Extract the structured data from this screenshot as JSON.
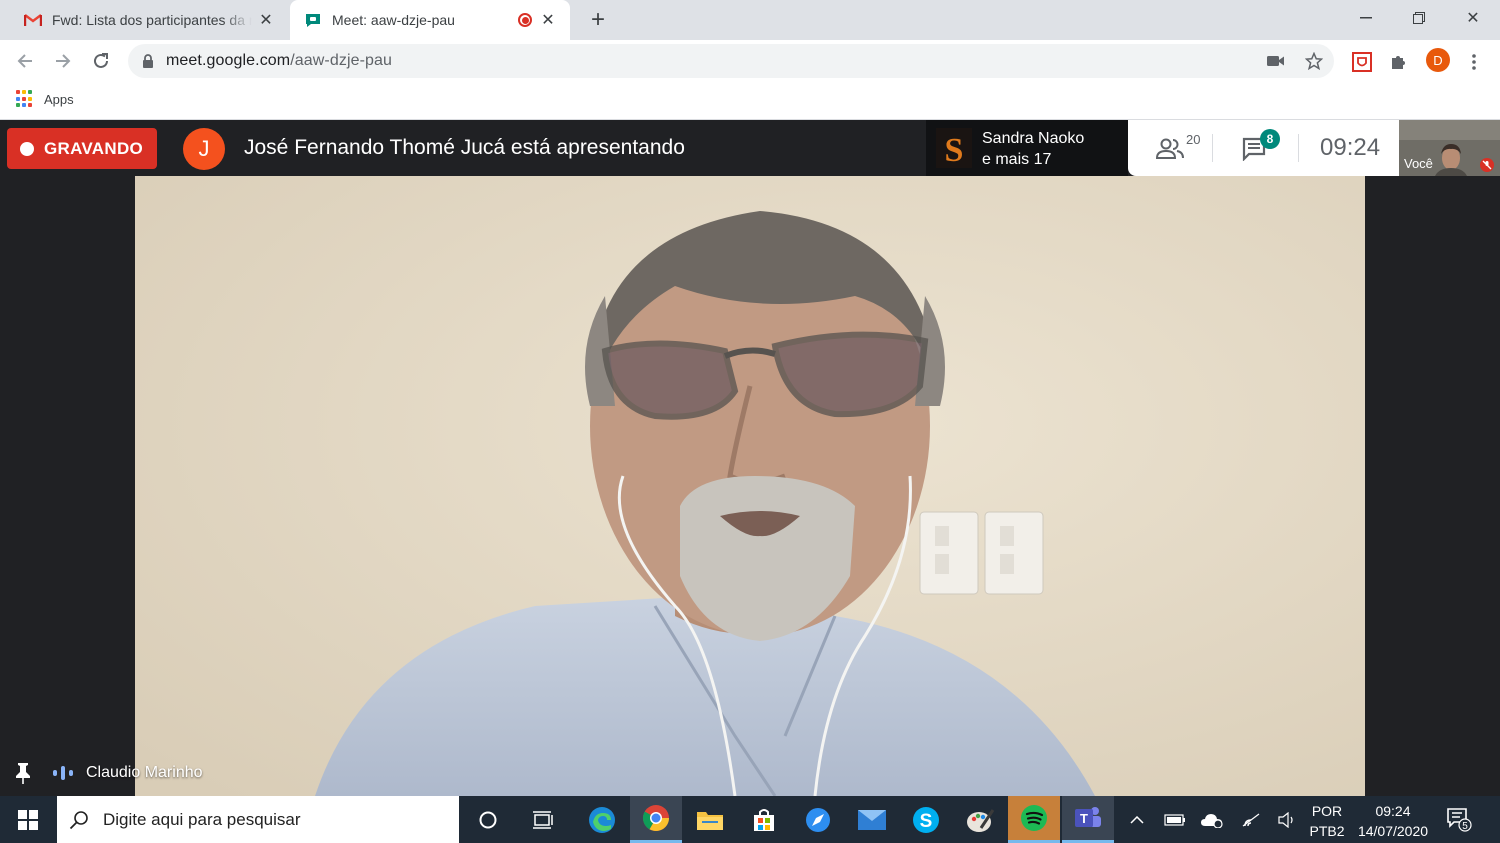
{
  "browser": {
    "tabs": [
      {
        "title": "Fwd: Lista dos participantes da re",
        "icon": "gmail-icon"
      },
      {
        "title": "Meet: aaw-dzje-pau",
        "icon": "meet-icon",
        "recording": true
      }
    ],
    "url_host": "meet.google.com",
    "url_path": "/aaw-dzje-pau",
    "profile_initial": "D",
    "bookmarks": [
      {
        "label": "Apps"
      }
    ]
  },
  "meet": {
    "recording_label": "GRAVANDO",
    "presenter_initial": "J",
    "presenting_text": "José Fernando Thomé Jucá está apresentando",
    "speaker": {
      "line1": "Sandra Naoko",
      "line2": "e mais 17"
    },
    "participants_count": "20",
    "chat_unread": "8",
    "time": "09:24",
    "self_label": "Você",
    "tile_name": "Claudio Marinho"
  },
  "taskbar": {
    "search_placeholder": "Digite aqui para pesquisar",
    "language_line1": "POR",
    "language_line2": "PTB2",
    "time": "09:24",
    "date": "14/07/2020",
    "notification_count": "5"
  },
  "colors": {
    "recording_red": "#d93025",
    "presenter_avatar": "#f4511e",
    "chat_badge": "#00897b",
    "profile_avatar": "#e8590c",
    "taskbar": "#1f2a36"
  }
}
